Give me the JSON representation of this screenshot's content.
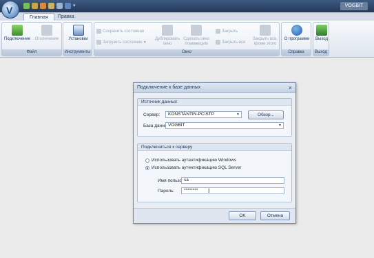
{
  "app": {
    "title": "VOGBIT"
  },
  "tabs": [
    {
      "label": "Главная",
      "active": true
    },
    {
      "label": "Правка",
      "active": false
    }
  ],
  "ribbon": {
    "file": {
      "label": "Файл",
      "connect": "Подключение",
      "disconnect": "Отключение"
    },
    "tools": {
      "label": "Инструменты",
      "settings": "Установки"
    },
    "window": {
      "label": "Окно",
      "save_state": "Сохранить состояние",
      "load_state": "Загрузить состояние",
      "duplicate": "Дублировать окно",
      "make_floating": "Сделать окно плавающим",
      "close": "Закрыть",
      "close_all": "Закрыть все",
      "close_all_except": "Закрыть все, кроме этого"
    },
    "help": {
      "label": "Справка",
      "about": "О программе"
    },
    "exit": {
      "label": "Выход",
      "exit": "Выход"
    }
  },
  "dialog": {
    "title": "Подключение к базе данных",
    "close_glyph": "×",
    "source": {
      "header": "Источник данных",
      "server_label": "Сервер:",
      "server_value": "KONSTANTIN-PC\\STP",
      "browse_label": "Обзор...",
      "db_label": "База данных:",
      "db_value": "VOGBIT"
    },
    "auth": {
      "header": "Подключиться к серверу",
      "windows_auth": "Использовать аутентификацию Windows",
      "sql_auth": "Использовать аутентификацию SQL Server",
      "selected": "sql",
      "user_label": "Имя пользователя:",
      "user_value": "sa",
      "password_label": "Пароль:",
      "password_value": "********"
    },
    "ok_label": "OK",
    "cancel_label": "Отмена"
  },
  "colors": {
    "titlebar": "#2b4468",
    "accent": "#1f5fa8"
  }
}
